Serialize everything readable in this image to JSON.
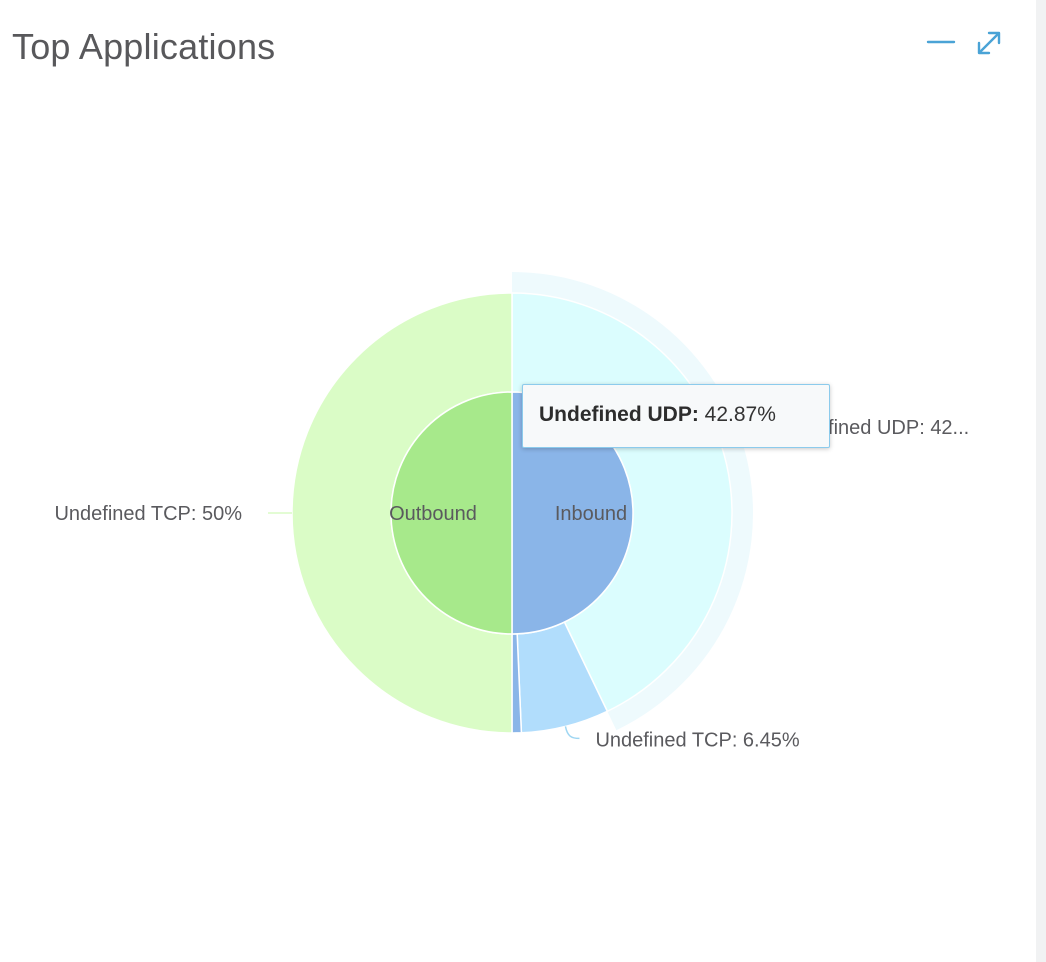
{
  "header": {
    "title": "Top Applications"
  },
  "controls": {
    "minimize_icon": "minimize-icon",
    "expand_icon": "expand-icon"
  },
  "colors": {
    "outbound_inner": "#a7e98b",
    "inbound_inner": "#8ab5e8",
    "tcp_outbound_outer": "#dafcc6",
    "udp_inbound_outer": "#dbfdfe",
    "tcp_inbound_outer": "#b1ddfc",
    "other_sliver": "#8ab5e8",
    "hover_halo": "#eefafd",
    "accent_icon": "#4aa3d6"
  },
  "tooltip": {
    "name": "Undefined UDP:",
    "value": "42.87%"
  },
  "chart_data": {
    "type": "pie",
    "inner": {
      "categories": [
        "Outbound",
        "Inbound"
      ],
      "values": [
        50,
        50
      ]
    },
    "outer": {
      "series": [
        {
          "name": "Undefined TCP",
          "parent": "Outbound",
          "value": 50,
          "label": "Undefined TCP: 50%"
        },
        {
          "name": "Undefined UDP",
          "parent": "Inbound",
          "value": 42.87,
          "label": "Undefined UDP: 42..."
        },
        {
          "name": "Undefined TCP",
          "parent": "Inbound",
          "value": 6.45,
          "label": "Undefined TCP: 6.45%"
        },
        {
          "name": "",
          "parent": "Inbound",
          "value": 0.68,
          "label": ""
        }
      ],
      "highlighted": "Undefined UDP"
    }
  }
}
